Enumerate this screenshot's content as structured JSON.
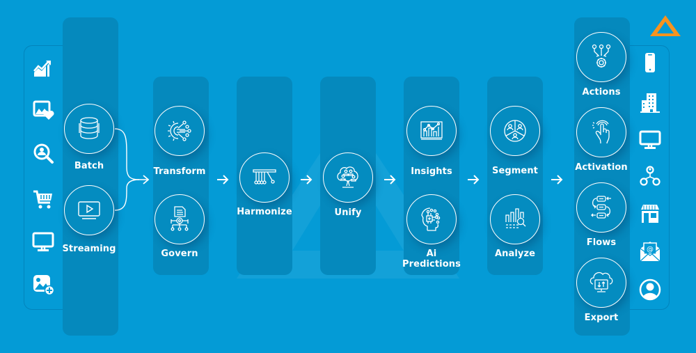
{
  "brand": {
    "logo": "triangle-logo-icon",
    "accent_color": "#F7931E",
    "background_color": "#049BD6",
    "column_color": "#0589BD"
  },
  "sources": {
    "icons": [
      "growth-chart-icon",
      "image-heart-icon",
      "user-search-icon",
      "shopping-cart-icon",
      "monitor-icon",
      "image-add-icon"
    ]
  },
  "stages": [
    {
      "nodes": [
        {
          "label": "Batch",
          "icon": "database-icon"
        },
        {
          "label": "Streaming",
          "icon": "video-play-icon"
        }
      ]
    },
    {
      "nodes": [
        {
          "label": "Transform",
          "icon": "gear-network-icon"
        },
        {
          "label": "Govern",
          "icon": "document-gear-icon"
        }
      ]
    },
    {
      "nodes": [
        {
          "label": "Harmonize",
          "icon": "newtons-cradle-icon"
        }
      ]
    },
    {
      "nodes": [
        {
          "label": "Unify",
          "icon": "people-tree-icon"
        }
      ]
    },
    {
      "nodes": [
        {
          "label": "Insights",
          "icon": "analytics-chart-icon"
        },
        {
          "label": "Ai\nPredictions",
          "icon": "ai-head-icon"
        }
      ]
    },
    {
      "nodes": [
        {
          "label": "Segment",
          "icon": "audience-segment-icon"
        },
        {
          "label": "Analyze",
          "icon": "bar-search-icon"
        }
      ]
    },
    {
      "nodes": [
        {
          "label": "Actions",
          "icon": "gear-inputs-icon"
        },
        {
          "label": "Activation",
          "icon": "touch-hand-icon"
        },
        {
          "label": "Flows",
          "icon": "flow-cycle-icon"
        },
        {
          "label": "Export",
          "icon": "cloud-export-icon"
        }
      ]
    }
  ],
  "flow_arrows": 6,
  "destinations": {
    "icons": [
      "mobile-phone-icon",
      "building-icon",
      "desktop-icon",
      "user-network-icon",
      "store-icon",
      "email-icon",
      "user-profile-icon"
    ]
  }
}
